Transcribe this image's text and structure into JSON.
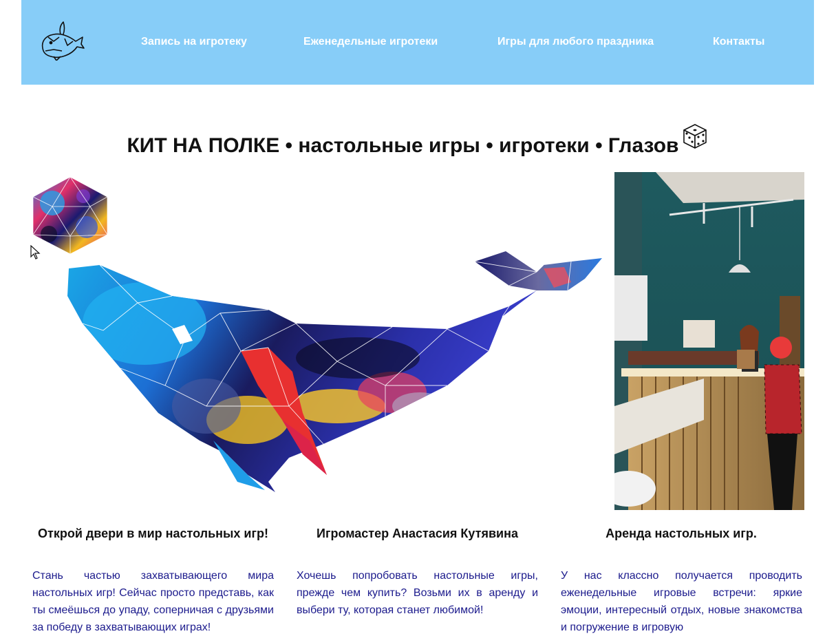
{
  "header": {
    "nav": [
      {
        "label": "Запись на игротеку"
      },
      {
        "label": "Еженедельные игротеки"
      },
      {
        "label": "Игры для любого праздника"
      },
      {
        "label": "Контакты"
      }
    ],
    "logo_icon": "whale-logo-icon"
  },
  "hero": {
    "title": "КИТ НА ПОЛКЕ • настольные игры • игротеки • Глазов",
    "title_icon": "dice-icon"
  },
  "columns": [
    {
      "heading": "Открой двери в мир настольных игр!",
      "text": "Стань частью захватывающего мира настольных игр! Сейчас просто представь, как ты смеёшься до упаду, соперничая с друзьями за победу в захватывающих играх!"
    },
    {
      "heading": "Игромастер Анастасия Кутявина",
      "text": "Хочешь попробовать настольные игры, прежде чем купить? Возьми их в аренду и выбери ту, которая станет любимой!"
    },
    {
      "heading": "Аренда настольных игр.",
      "text": "У нас классно получается проводить еженедельные игровые встречи: яркие эмоции, интересный отдых, новые знакомства и погружение в игровую"
    }
  ],
  "colors": {
    "header_bg": "#87cdf8",
    "nav_text": "#ffffff",
    "body_text": "#1b1a8c",
    "heading_text": "#111111"
  }
}
